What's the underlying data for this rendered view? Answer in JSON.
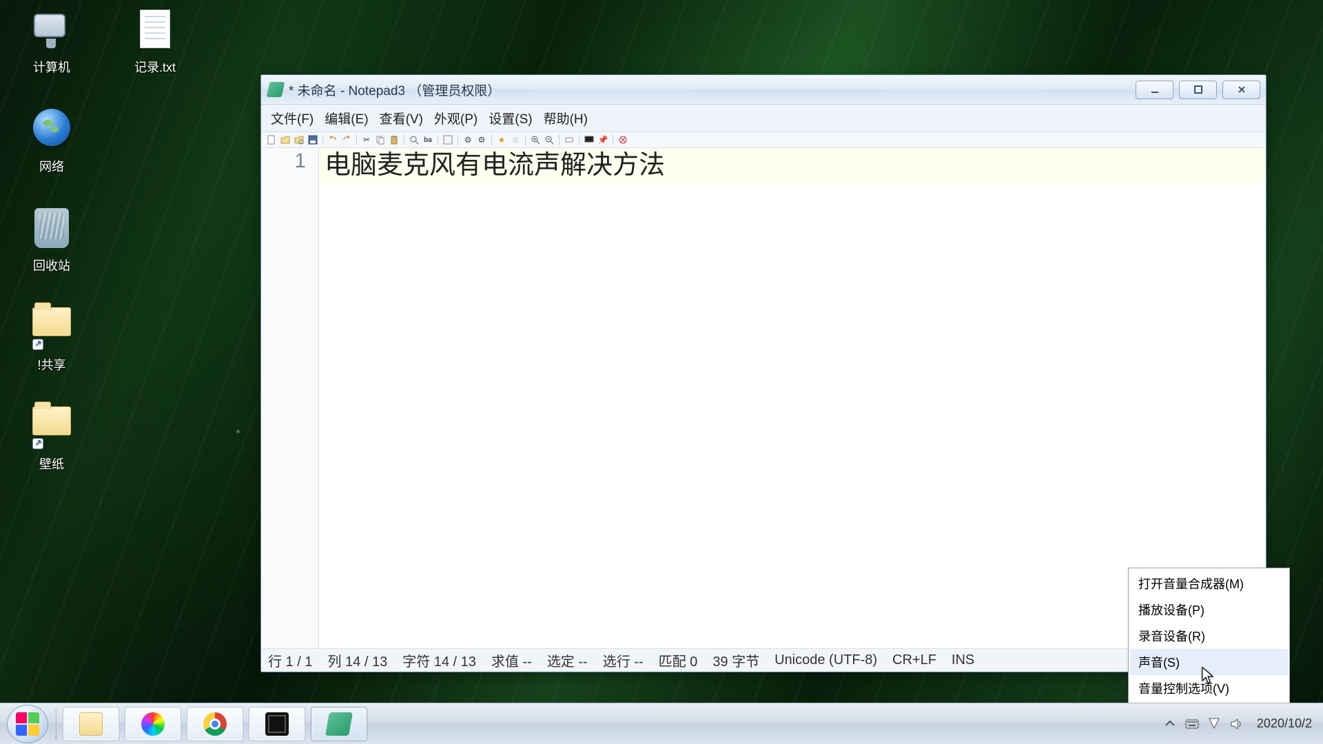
{
  "desktop": {
    "icons": [
      {
        "name": "computer",
        "label": "计算机"
      },
      {
        "name": "record-txt",
        "label": "记录.txt"
      },
      {
        "name": "network",
        "label": "网络"
      },
      {
        "name": "recycle-bin",
        "label": "回收站"
      },
      {
        "name": "share-folder",
        "label": "!共享"
      },
      {
        "name": "wallpaper-folder",
        "label": "壁纸"
      }
    ]
  },
  "window": {
    "title": "* 未命名 - Notepad3 （管理员权限）",
    "menus": {
      "file": "文件(F)",
      "edit": "编辑(E)",
      "view": "查看(V)",
      "appearance": "外观(P)",
      "settings": "设置(S)",
      "help": "帮助(H)"
    },
    "editor": {
      "line_number": "1",
      "text": "电脑麦克风有电流声解决方法"
    },
    "status": {
      "row": "行  1 / 1",
      "col": "列  14 / 13",
      "chars": "字符  14 / 13",
      "eval": "求值  --",
      "sel": "选定  --",
      "sellines": "选行  --",
      "matches": "匹配  0",
      "bytes": "39 字节",
      "enc": "Unicode (UTF-8)",
      "eol": "CR+LF",
      "mode": "INS"
    }
  },
  "sound_menu": {
    "items": {
      "mixer": "打开音量合成器(M)",
      "playback": "播放设备(P)",
      "recording": "录音设备(R)",
      "sounds": "声音(S)",
      "volume_opts": "音量控制选项(V)"
    }
  },
  "taskbar": {
    "date": "2020/10/2"
  }
}
